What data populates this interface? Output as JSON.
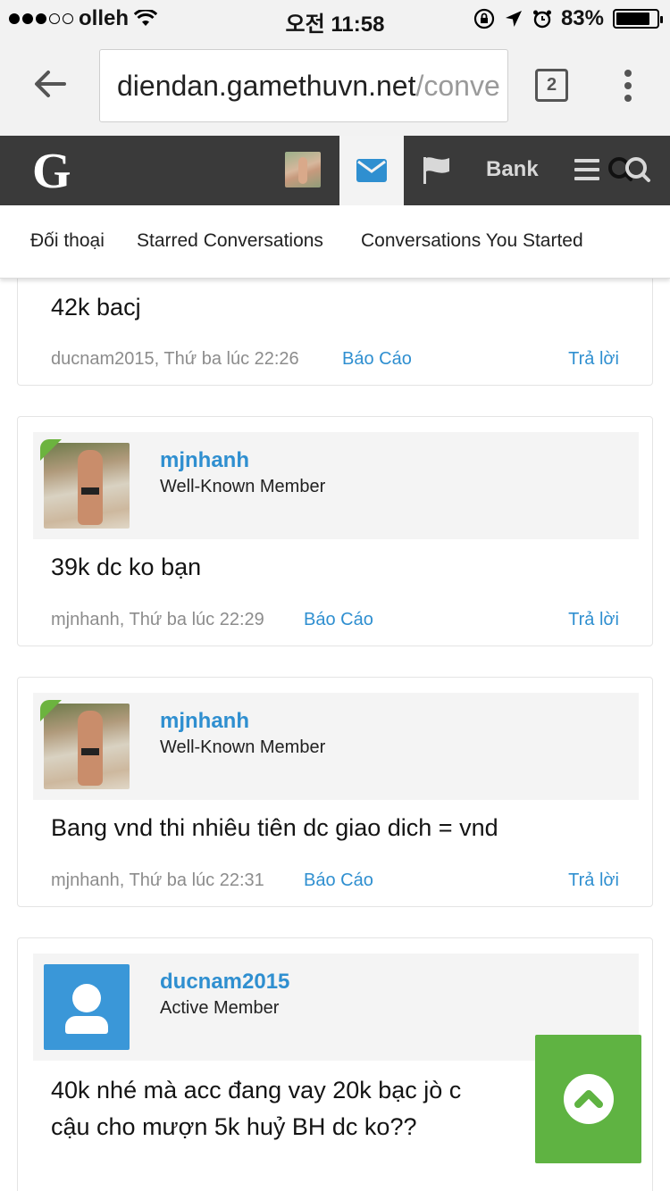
{
  "status_bar": {
    "carrier": "olleh",
    "time": "오전 11:58",
    "battery_percent": "83%",
    "battery_level": 0.83
  },
  "browser": {
    "url_domain": "diendan.gamethuvn.net",
    "url_rest": "/conve",
    "tab_count": "2"
  },
  "site_nav": {
    "logo": "G",
    "bank_label": "Bank",
    "icons": [
      "user-avatar",
      "mail-icon",
      "flag-icon",
      "menu-icon",
      "search-icon"
    ]
  },
  "subnav": {
    "items": [
      "Đối thoại",
      "Starred Conversations",
      "Conversations You Started"
    ]
  },
  "posts": [
    {
      "message": "42k bacj",
      "author": "ducnam2015",
      "time": "Thứ ba lúc 22:26",
      "report_label": "Báo Cáo",
      "reply_label": "Trả lời"
    },
    {
      "username": "mjnhanh",
      "user_title": "Well-Known Member",
      "message": "39k dc ko bạn",
      "author": "mjnhanh",
      "time": "Thứ ba lúc 22:29",
      "report_label": "Báo Cáo",
      "reply_label": "Trả lời"
    },
    {
      "username": "mjnhanh",
      "user_title": "Well-Known Member",
      "message": "Bang vnd thi nhiêu tiên dc giao dich = vnd",
      "author": "mjnhanh",
      "time": "Thứ ba lúc 22:31",
      "report_label": "Báo Cáo",
      "reply_label": "Trả lời"
    },
    {
      "username": "ducnam2015",
      "user_title": "Active Member",
      "message_line1": "40k nhé mà acc đang vay 20k bạc jò c",
      "message_line2": "cậu cho mượn 5k huỷ BH dc ko??"
    }
  ],
  "colors": {
    "link_blue": "#2f8fd0",
    "nav_dark": "#3a3a3a",
    "scroll_top_green": "#5fb342",
    "online_badge_green": "#6cb33f"
  }
}
